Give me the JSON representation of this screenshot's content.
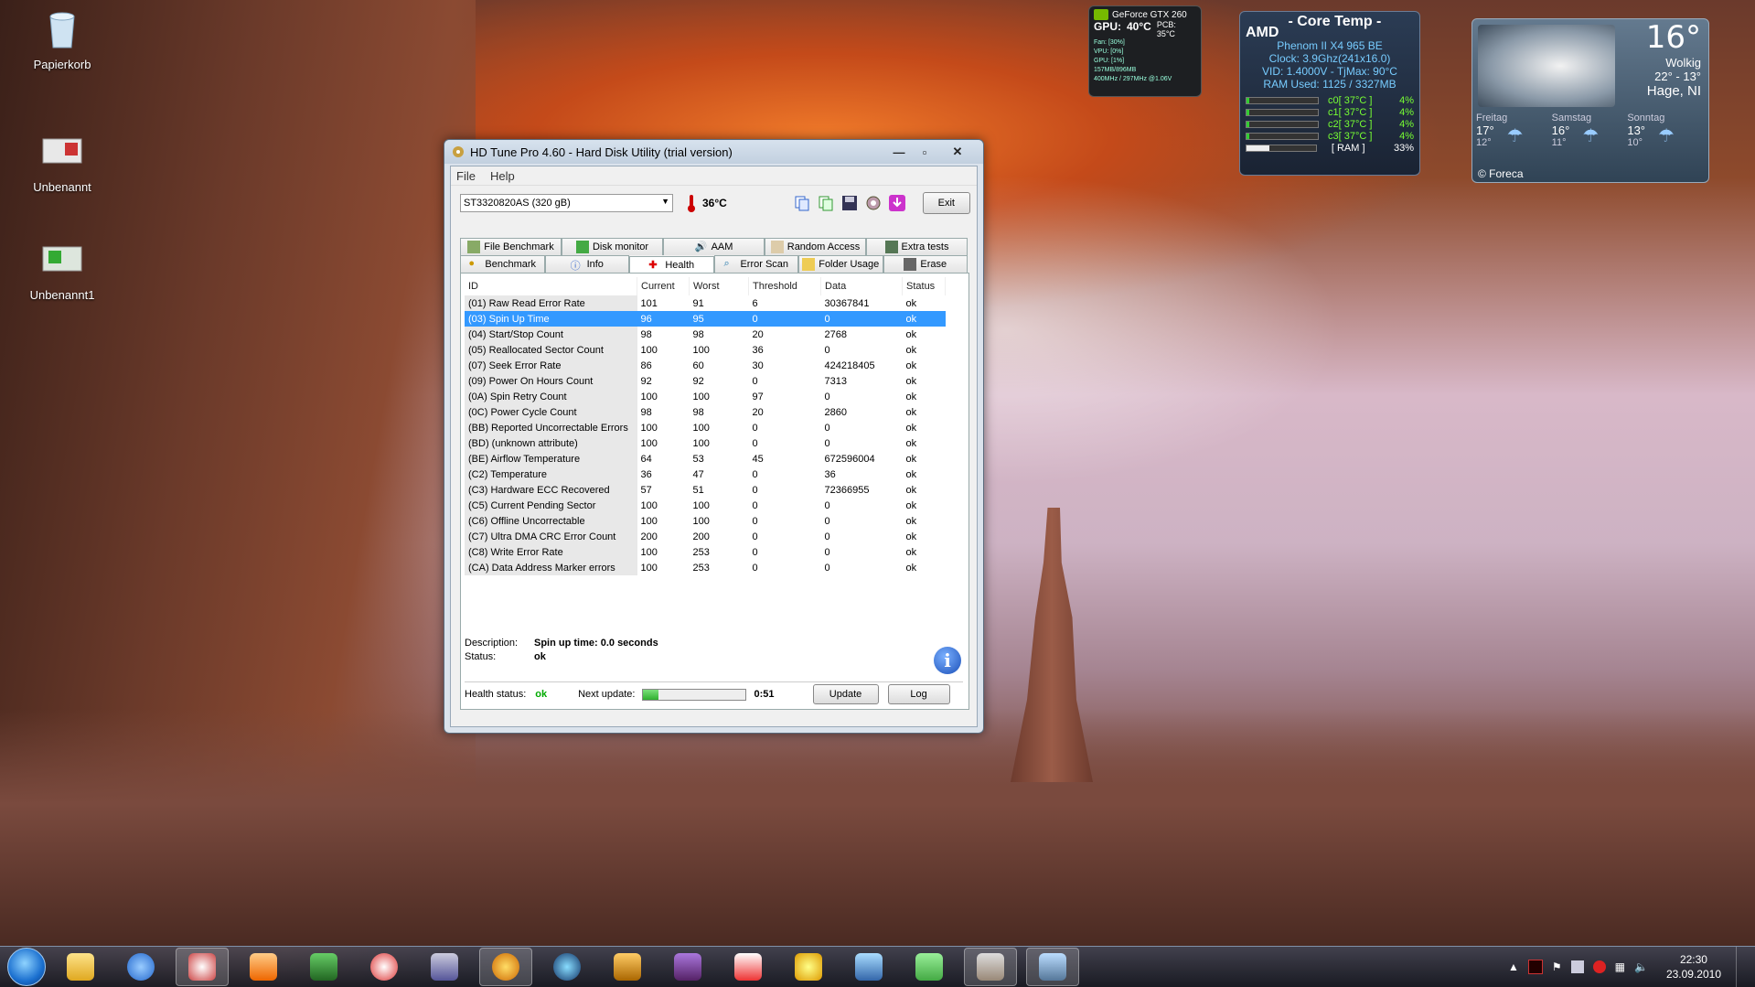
{
  "desktop": {
    "icons": [
      {
        "label": "Papierkorb"
      },
      {
        "label": "Unbenannt"
      },
      {
        "label": "Unbenannt1"
      }
    ]
  },
  "gpu_gadget": {
    "name": "GeForce GTX 260",
    "gpu_label": "GPU:",
    "gpu_temp": "40°C",
    "pcb_temp": "PCB: 35°C",
    "lines": [
      "Fan: [30%]",
      "VPU: [0%]",
      "GPU: [1%]",
      "157MB/896MB",
      "400MHz / 297MHz @1.06V"
    ]
  },
  "coretemp": {
    "brand": "AMD",
    "title": "- Core Temp -",
    "cpu": "Phenom II X4 965 BE",
    "clock": "Clock: 3.9Ghz(241x16.0)",
    "vid": "VID: 1.4000V - TjMax: 90°C",
    "ram": "RAM Used: 1125 / 3327MB",
    "cores": [
      {
        "label": "c0[ 37°C ]",
        "load": "4%",
        "value": 4
      },
      {
        "label": "c1[ 37°C ]",
        "load": "4%",
        "value": 4
      },
      {
        "label": "c2[ 37°C ]",
        "load": "4%",
        "value": 4
      },
      {
        "label": "c3[ 37°C ]",
        "load": "4%",
        "value": 4
      },
      {
        "label": "[ RAM ]",
        "load": "33%",
        "value": 33
      }
    ]
  },
  "weather": {
    "temp": "16°",
    "condition": "Wolkig",
    "range": "22° - 13°",
    "location": "Hage, NI",
    "days": [
      {
        "name": "Freitag",
        "high": "17°",
        "low": "12°"
      },
      {
        "name": "Samstag",
        "high": "16°",
        "low": "11°"
      },
      {
        "name": "Sonntag",
        "high": "13°",
        "low": "10°"
      }
    ],
    "credit": "© Foreca"
  },
  "window": {
    "title": "HD Tune Pro 4.60 - Hard Disk Utility (trial version)",
    "menu": [
      "File",
      "Help"
    ],
    "drive": "ST3320820AS (320 gB)",
    "temperature": "36°C",
    "exit_label": "Exit",
    "tabs_row1": [
      "File Benchmark",
      "Disk monitor",
      "AAM",
      "Random Access",
      "Extra tests"
    ],
    "tabs_row2": [
      "Benchmark",
      "Info",
      "Health",
      "Error Scan",
      "Folder Usage",
      "Erase"
    ],
    "columns": [
      "ID",
      "Current",
      "Worst",
      "Threshold",
      "Data",
      "Status"
    ],
    "rows": [
      [
        "(01) Raw Read Error Rate",
        "101",
        "91",
        "6",
        "30367841",
        "ok"
      ],
      [
        "(03) Spin Up Time",
        "96",
        "95",
        "0",
        "0",
        "ok"
      ],
      [
        "(04) Start/Stop Count",
        "98",
        "98",
        "20",
        "2768",
        "ok"
      ],
      [
        "(05) Reallocated Sector Count",
        "100",
        "100",
        "36",
        "0",
        "ok"
      ],
      [
        "(07) Seek Error Rate",
        "86",
        "60",
        "30",
        "424218405",
        "ok"
      ],
      [
        "(09) Power On Hours Count",
        "92",
        "92",
        "0",
        "7313",
        "ok"
      ],
      [
        "(0A) Spin Retry Count",
        "100",
        "100",
        "97",
        "0",
        "ok"
      ],
      [
        "(0C) Power Cycle Count",
        "98",
        "98",
        "20",
        "2860",
        "ok"
      ],
      [
        "(BB) Reported Uncorrectable Errors",
        "100",
        "100",
        "0",
        "0",
        "ok"
      ],
      [
        "(BD) (unknown attribute)",
        "100",
        "100",
        "0",
        "0",
        "ok"
      ],
      [
        "(BE) Airflow Temperature",
        "64",
        "53",
        "45",
        "672596004",
        "ok"
      ],
      [
        "(C2) Temperature",
        "36",
        "47",
        "0",
        "36",
        "ok"
      ],
      [
        "(C3) Hardware ECC Recovered",
        "57",
        "51",
        "0",
        "72366955",
        "ok"
      ],
      [
        "(C5) Current Pending Sector",
        "100",
        "100",
        "0",
        "0",
        "ok"
      ],
      [
        "(C6) Offline Uncorrectable",
        "100",
        "100",
        "0",
        "0",
        "ok"
      ],
      [
        "(C7) Ultra DMA CRC Error Count",
        "200",
        "200",
        "0",
        "0",
        "ok"
      ],
      [
        "(C8) Write Error Rate",
        "100",
        "253",
        "0",
        "0",
        "ok"
      ],
      [
        "(CA) Data Address Marker errors",
        "100",
        "253",
        "0",
        "0",
        "ok"
      ]
    ],
    "description_label": "Description:",
    "description_value": "Spin up time: 0.0 seconds",
    "status_label": "Status:",
    "status_value": "ok",
    "health_label": "Health status:",
    "health_value": "ok",
    "next_update_label": "Next update:",
    "next_update_value": "0:51",
    "next_update_progress": 0.15,
    "update_label": "Update",
    "log_label": "Log"
  },
  "taskbar": {
    "time": "22:30",
    "date": "23.09.2010"
  }
}
